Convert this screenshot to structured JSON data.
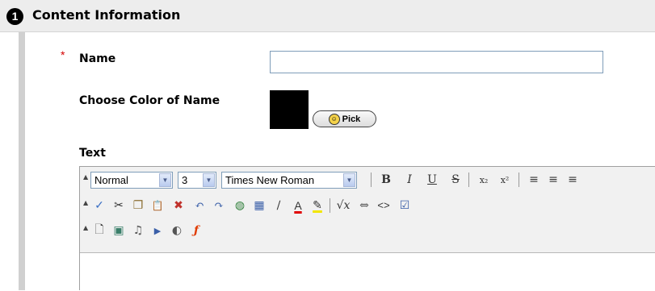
{
  "section": {
    "step_number": "1",
    "title": "Content Information"
  },
  "form": {
    "required_marker": "*",
    "name_label": "Name",
    "name_value": "",
    "color_label": "Choose Color of Name",
    "selected_color": "#000000",
    "pick_label": "Pick",
    "text_label": "Text"
  },
  "toolbar": {
    "collapse_glyph": "▲",
    "style_select": "Normal",
    "size_select": "3",
    "font_select": "Times New Roman",
    "dropdown_glyph": "▼",
    "row1_buttons": [
      {
        "icon": "bold-icon",
        "glyph": "B"
      },
      {
        "icon": "italic-icon",
        "glyph": "I"
      },
      {
        "icon": "underline-icon",
        "glyph": "U"
      },
      {
        "icon": "strikethrough-icon",
        "glyph": "S"
      },
      {
        "icon": "subscript-icon",
        "glyph": "x₂"
      },
      {
        "icon": "superscript-icon",
        "glyph": "x²"
      },
      {
        "icon": "align-left-icon",
        "glyph": "≡"
      },
      {
        "icon": "align-center-icon",
        "glyph": "≡"
      },
      {
        "icon": "align-right-icon",
        "glyph": "≡"
      }
    ],
    "row2_buttons": [
      {
        "icon": "spellcheck-icon",
        "glyph": "✓"
      },
      {
        "icon": "cut-icon",
        "glyph": "✂"
      },
      {
        "icon": "copy-icon",
        "glyph": "❐"
      },
      {
        "icon": "paste-icon",
        "glyph": "📋"
      },
      {
        "icon": "remove-format-icon",
        "glyph": "✖"
      },
      {
        "icon": "undo-icon",
        "glyph": "↶"
      },
      {
        "icon": "redo-icon",
        "glyph": "↷"
      },
      {
        "icon": "insert-link-icon",
        "glyph": "◍"
      },
      {
        "icon": "insert-table-icon",
        "glyph": "▦"
      },
      {
        "icon": "draw-line-icon",
        "glyph": "∕"
      },
      {
        "icon": "text-color-icon",
        "glyph": "A"
      },
      {
        "icon": "highlight-icon",
        "glyph": "✎"
      },
      {
        "icon": "equation-icon",
        "glyph": "√x"
      },
      {
        "icon": "anchor-icon",
        "glyph": "⇔"
      },
      {
        "icon": "html-source-icon",
        "glyph": "<>"
      },
      {
        "icon": "preview-icon",
        "glyph": "☑"
      }
    ],
    "row3_buttons": [
      {
        "icon": "insert-file-icon",
        "glyph": "🗋"
      },
      {
        "icon": "insert-image-icon",
        "glyph": "▣"
      },
      {
        "icon": "insert-audio-icon",
        "glyph": "♫"
      },
      {
        "icon": "insert-video-icon",
        "glyph": "▶"
      },
      {
        "icon": "insert-applet-icon",
        "glyph": "◐"
      },
      {
        "icon": "insert-flash-icon",
        "glyph": "ƒ"
      }
    ],
    "colors": {
      "text_color_bar": "#e00000",
      "highlight_bar": "#f2e600",
      "flash": "#e03a00"
    }
  }
}
